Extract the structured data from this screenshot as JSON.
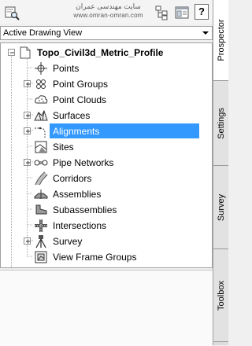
{
  "toolbar": {
    "watermark_line1": "سایت مهندسی عمران",
    "watermark_line2": "www.omran-omran.com",
    "help_label": "?",
    "icons": [
      "search-icon",
      "tree-properties-icon",
      "item-view-icon"
    ]
  },
  "view_select": {
    "selected": "Active Drawing View"
  },
  "tree": {
    "root_label": "Topo_Civil3d_Metric_Profile",
    "items": [
      {
        "label": "Points",
        "icon": "points-icon",
        "expandable": false
      },
      {
        "label": "Point Groups",
        "icon": "point-groups-icon",
        "expandable": true
      },
      {
        "label": "Point Clouds",
        "icon": "point-clouds-icon",
        "expandable": false
      },
      {
        "label": "Surfaces",
        "icon": "surfaces-icon",
        "expandable": true
      },
      {
        "label": "Alignments",
        "icon": "alignments-icon",
        "expandable": true,
        "selected": true
      },
      {
        "label": "Sites",
        "icon": "sites-icon",
        "expandable": false
      },
      {
        "label": "Pipe Networks",
        "icon": "pipe-networks-icon",
        "expandable": true
      },
      {
        "label": "Corridors",
        "icon": "corridors-icon",
        "expandable": false
      },
      {
        "label": "Assemblies",
        "icon": "assemblies-icon",
        "expandable": false
      },
      {
        "label": "Subassemblies",
        "icon": "subassemblies-icon",
        "expandable": false
      },
      {
        "label": "Intersections",
        "icon": "intersections-icon",
        "expandable": false
      },
      {
        "label": "Survey",
        "icon": "survey-icon",
        "expandable": true
      },
      {
        "label": "View Frame Groups",
        "icon": "view-frame-groups-icon",
        "expandable": false
      }
    ]
  },
  "side_tabs": [
    {
      "label": "Prospector",
      "active": true
    },
    {
      "label": "Settings",
      "active": false
    },
    {
      "label": "Survey",
      "active": false
    },
    {
      "label": "Toolbox",
      "active": false
    }
  ],
  "colors": {
    "selection": "#3399ff",
    "panel_bg": "#f0f0f0"
  }
}
